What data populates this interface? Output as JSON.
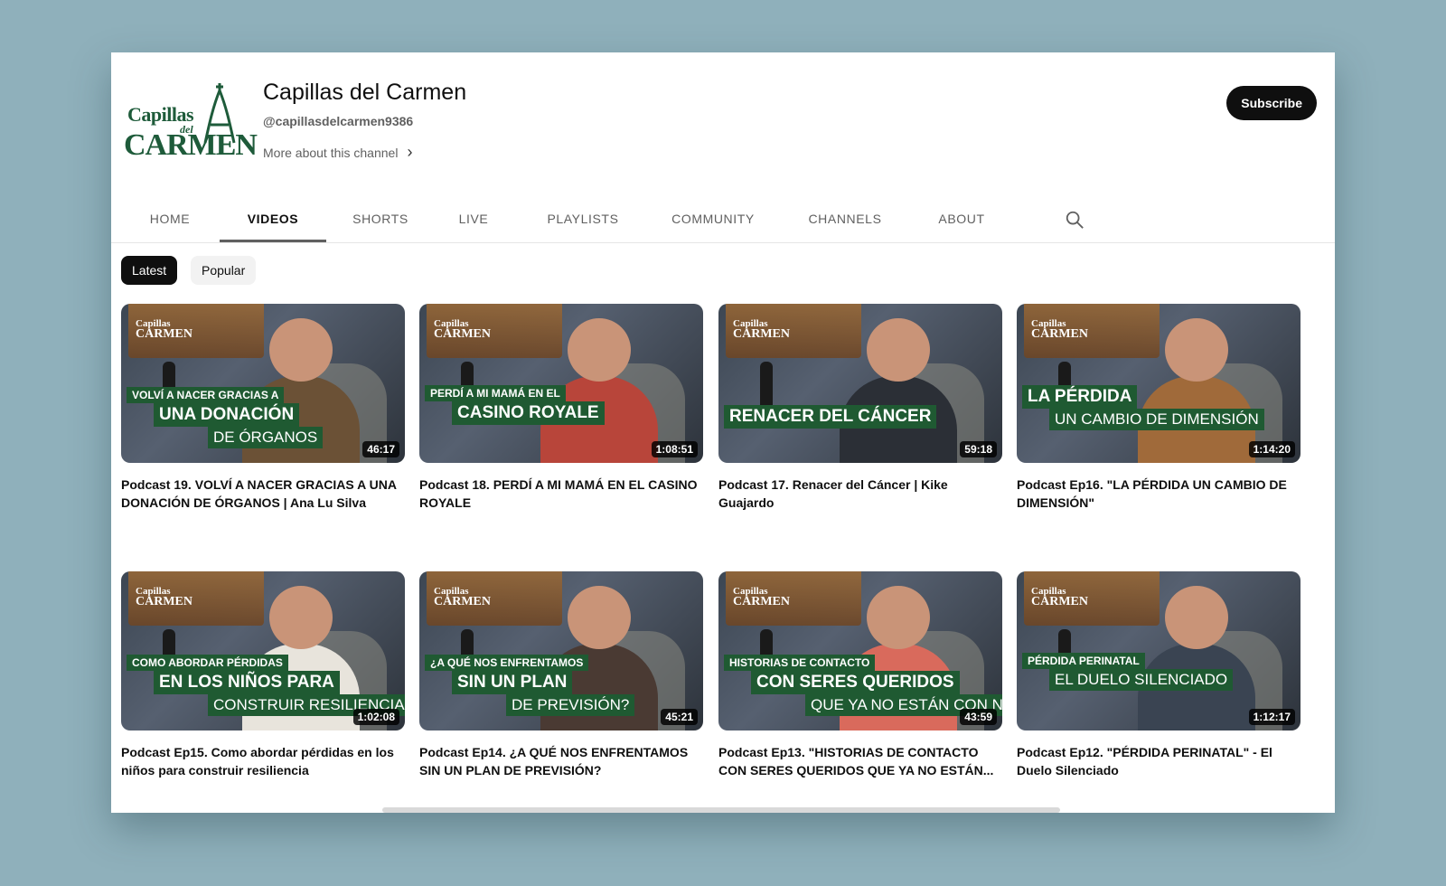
{
  "channel": {
    "logo_text": [
      "Capillas",
      "del",
      "CARMEN"
    ],
    "name": "Capillas del Carmen",
    "handle": "@capillasdelcarmen9386",
    "more_about": "More about this channel",
    "subscribe_label": "Subscribe"
  },
  "tabs": [
    {
      "label": "HOME",
      "active": false
    },
    {
      "label": "VIDEOS",
      "active": true
    },
    {
      "label": "SHORTS",
      "active": false
    },
    {
      "label": "LIVE",
      "active": false
    },
    {
      "label": "PLAYLISTS",
      "active": false
    },
    {
      "label": "COMMUNITY",
      "active": false
    },
    {
      "label": "CHANNELS",
      "active": false
    },
    {
      "label": "ABOUT",
      "active": false
    }
  ],
  "chips": [
    {
      "label": "Latest",
      "active": true
    },
    {
      "label": "Popular",
      "active": false
    }
  ],
  "videos": [
    {
      "thumb_lines": [
        "VOLVÍ A NACER GRACIAS A",
        "UNA DONACIÓN",
        "DE ÓRGANOS"
      ],
      "duration": "46:17",
      "title": "Podcast 19. VOLVÍ A NACER GRACIAS A UNA DONACIÓN DE ÓRGANOS | Ana Lu Silva"
    },
    {
      "thumb_lines": [
        "PERDÍ A MI MAMÁ EN EL",
        "CASINO ROYALE"
      ],
      "duration": "1:08:51",
      "title": "Podcast 18. PERDÍ A MI MAMÁ EN EL CASINO ROYALE"
    },
    {
      "thumb_lines": [
        "RENACER DEL CÁNCER"
      ],
      "duration": "59:18",
      "title": "Podcast 17. Renacer del Cáncer | Kike Guajardo"
    },
    {
      "thumb_lines": [
        "LA PÉRDIDA",
        "UN CAMBIO DE DIMENSIÓN"
      ],
      "duration": "1:14:20",
      "title": "Podcast Ep16. \"LA PÉRDIDA UN CAMBIO DE DIMENSIÓN\""
    },
    {
      "thumb_lines": [
        "COMO ABORDAR PÉRDIDAS",
        "EN LOS NIÑOS PARA",
        "CONSTRUIR RESILIENCIA"
      ],
      "duration": "1:02:08",
      "title": "Podcast Ep15. Como abordar pérdidas en los niños para construir resiliencia"
    },
    {
      "thumb_lines": [
        "¿A QUÉ NOS ENFRENTAMOS",
        "SIN UN PLAN",
        "DE PREVISIÓN?"
      ],
      "duration": "45:21",
      "title": "Podcast Ep14. ¿A QUÉ NOS ENFRENTAMOS SIN UN PLAN DE PREVISIÓN?"
    },
    {
      "thumb_lines": [
        "HISTORIAS DE CONTACTO",
        "CON SERES QUERIDOS",
        "QUE YA NO ESTÁN CON NOSOTROS"
      ],
      "duration": "43:59",
      "title": "Podcast Ep13. \"HISTORIAS DE CONTACTO CON SERES QUERIDOS QUE YA NO ESTÁN..."
    },
    {
      "thumb_lines": [
        "PÉRDIDA PERINATAL",
        "EL DUELO SILENCIADO"
      ],
      "duration": "1:12:17",
      "title": "Podcast Ep12. \"PÉRDIDA PERINATAL\" - El Duelo Silenciado"
    }
  ],
  "thumb_watermark": [
    "Capillas",
    "CARMEN"
  ],
  "colors": {
    "brand_green": "#1e5b3a",
    "overlay_green": "#1f5a32",
    "subscribe": "#0f0f0f"
  }
}
